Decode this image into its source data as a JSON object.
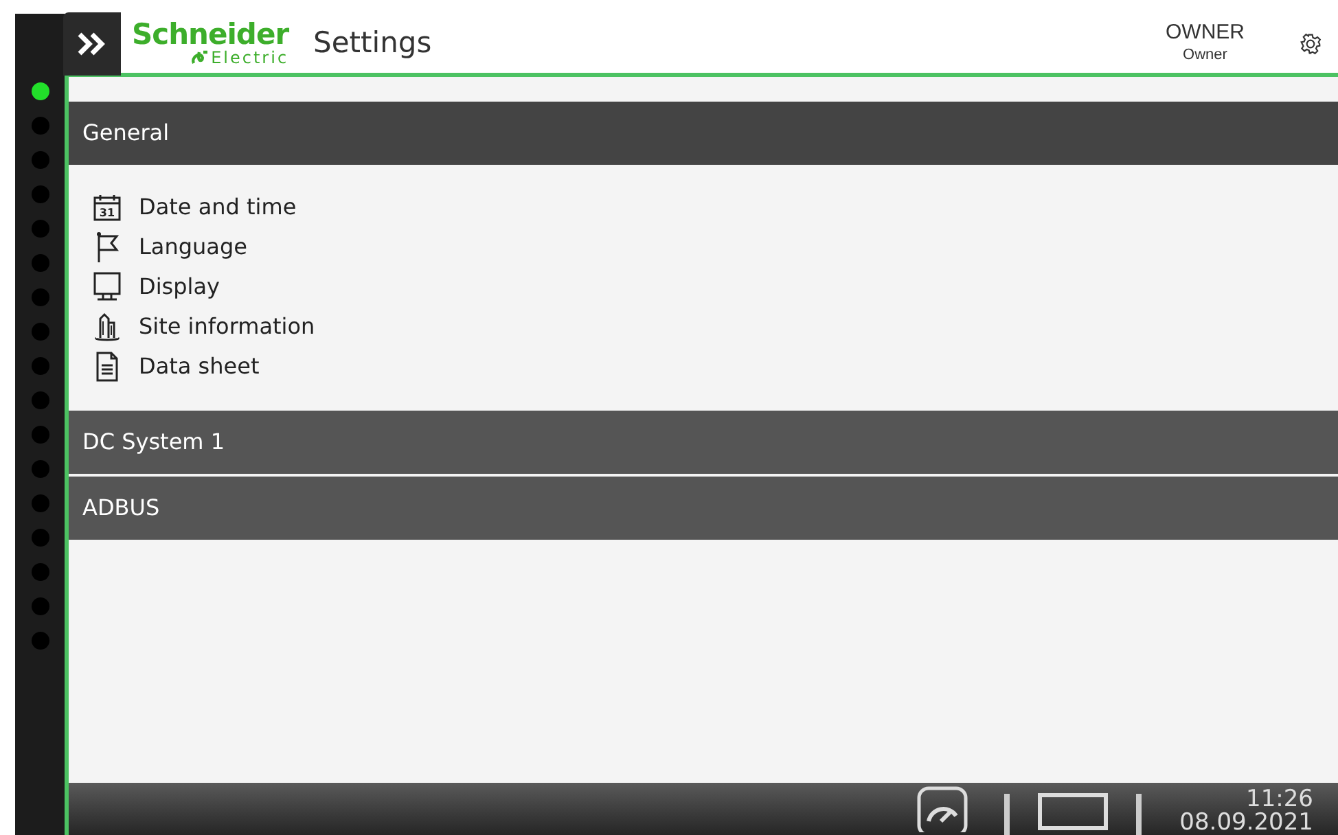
{
  "header": {
    "logo_line_1": "Schneider",
    "logo_line_2": "Electric",
    "title": "Settings",
    "user": "OWNER",
    "role": "Owner"
  },
  "page_indicator": [
    {
      "selected": true
    },
    {
      "selected": false
    },
    {
      "selected": false
    },
    {
      "selected": false
    },
    {
      "selected": false
    },
    {
      "selected": false
    },
    {
      "selected": false
    },
    {
      "selected": false
    },
    {
      "selected": false
    },
    {
      "selected": false
    },
    {
      "selected": false
    },
    {
      "selected": false
    },
    {
      "selected": false
    },
    {
      "selected": false
    },
    {
      "selected": false
    },
    {
      "selected": false
    },
    {
      "selected": false
    }
  ],
  "sections": [
    {
      "title": "General",
      "expanded": true,
      "items": [
        {
          "label": "Date and time",
          "icon_text": "31"
        },
        {
          "label": "Language"
        },
        {
          "label": "Display"
        },
        {
          "label": "Site information"
        },
        {
          "label": "Data sheet"
        }
      ]
    },
    {
      "title": "DC System 1",
      "expanded": false
    },
    {
      "title": "ADBUS",
      "expanded": false
    }
  ],
  "status_bar": {
    "time": "11:26",
    "date": "08.09.2021"
  }
}
